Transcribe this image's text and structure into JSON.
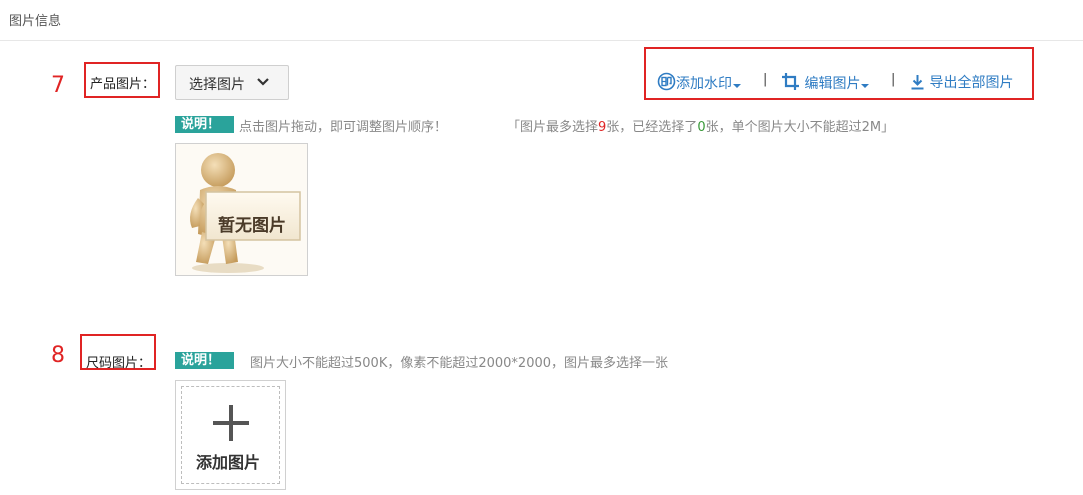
{
  "section": {
    "title": "图片信息"
  },
  "annotations": {
    "mark_7": "7",
    "mark_8": "8",
    "highlight_color": "#e02424"
  },
  "product_images": {
    "label": "产品图片：",
    "select_button": {
      "label": "选择图片",
      "icon": "chevron-down-icon"
    },
    "tools": {
      "watermark": {
        "label": "添加水印",
        "icon": "watermark-icon"
      },
      "separator": "|",
      "edit": {
        "label": "编辑图片",
        "icon": "crop-icon"
      },
      "export": {
        "label": "导出全部图片",
        "icon": "download-icon"
      }
    },
    "note_badge": "说明！",
    "note_text": "点击图片拖动，即可调整图片顺序！",
    "limit": {
      "prefix": "「图片最多选择",
      "max": "9",
      "middle": "张，已经选择了",
      "selected": "0",
      "suffix": "张，单个图片大小不能超过2M」"
    },
    "empty_thumbnail_text": "暂无图片"
  },
  "size_image": {
    "label": "尺码图片：",
    "note_badge": "说明！",
    "note_text": "图片大小不能超过500K，像素不能超过2000*2000，图片最多选择一张",
    "add_tile_label": "添加图片",
    "add_tile_icon": "plus-icon"
  },
  "colors": {
    "link": "#2f7cc3",
    "badge": "#2aa39b",
    "accent_red": "#e02424"
  }
}
